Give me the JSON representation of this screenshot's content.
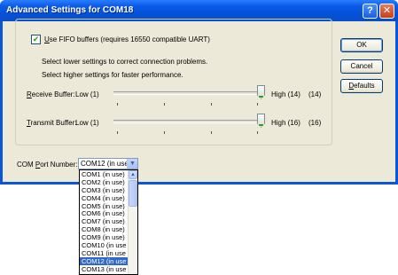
{
  "window": {
    "title": "Advanced Settings for COM18",
    "help_glyph": "?",
    "close_glyph": "✕"
  },
  "fifo": {
    "checked": true,
    "label_prefix": "U",
    "label_rest": "se FIFO buffers (requires 16550 compatible UART)"
  },
  "hints": {
    "line1": "Select lower settings to correct connection problems.",
    "line2": "Select higher settings for faster performance."
  },
  "receive": {
    "label_accel": "R",
    "label_rest": "eceive Buffer:",
    "low": "Low (1)",
    "high": "High (14)",
    "value": "(14)",
    "level": 1.0
  },
  "transmit": {
    "label_accel": "T",
    "label_rest": "ransmit Buffer:",
    "low": "Low (1)",
    "high": "High (16)",
    "value": "(16)",
    "level": 1.0
  },
  "buttons": {
    "ok": "OK",
    "cancel": "Cancel",
    "defaults_accel": "D",
    "defaults_rest": "efaults"
  },
  "com_port": {
    "label_before": "COM ",
    "label_accel": "P",
    "label_after": "ort Number:",
    "selected": "COM12 (in use",
    "options": [
      "COM1 (in use)",
      "COM2 (in use)",
      "COM3 (in use)",
      "COM4 (in use)",
      "COM5 (in use)",
      "COM6 (in use)",
      "COM7 (in use)",
      "COM8 (in use)",
      "COM9 (in use)",
      "COM10 (in use",
      "COM11 (in use",
      "COM12 (in use",
      "COM13 (in use"
    ],
    "selected_index": 11
  },
  "colors": {
    "title_bar": "#0a56d8",
    "dialog_bg": "#ece9d8",
    "selection": "#316ac5",
    "slider_thumb_accent": "#21a121"
  }
}
